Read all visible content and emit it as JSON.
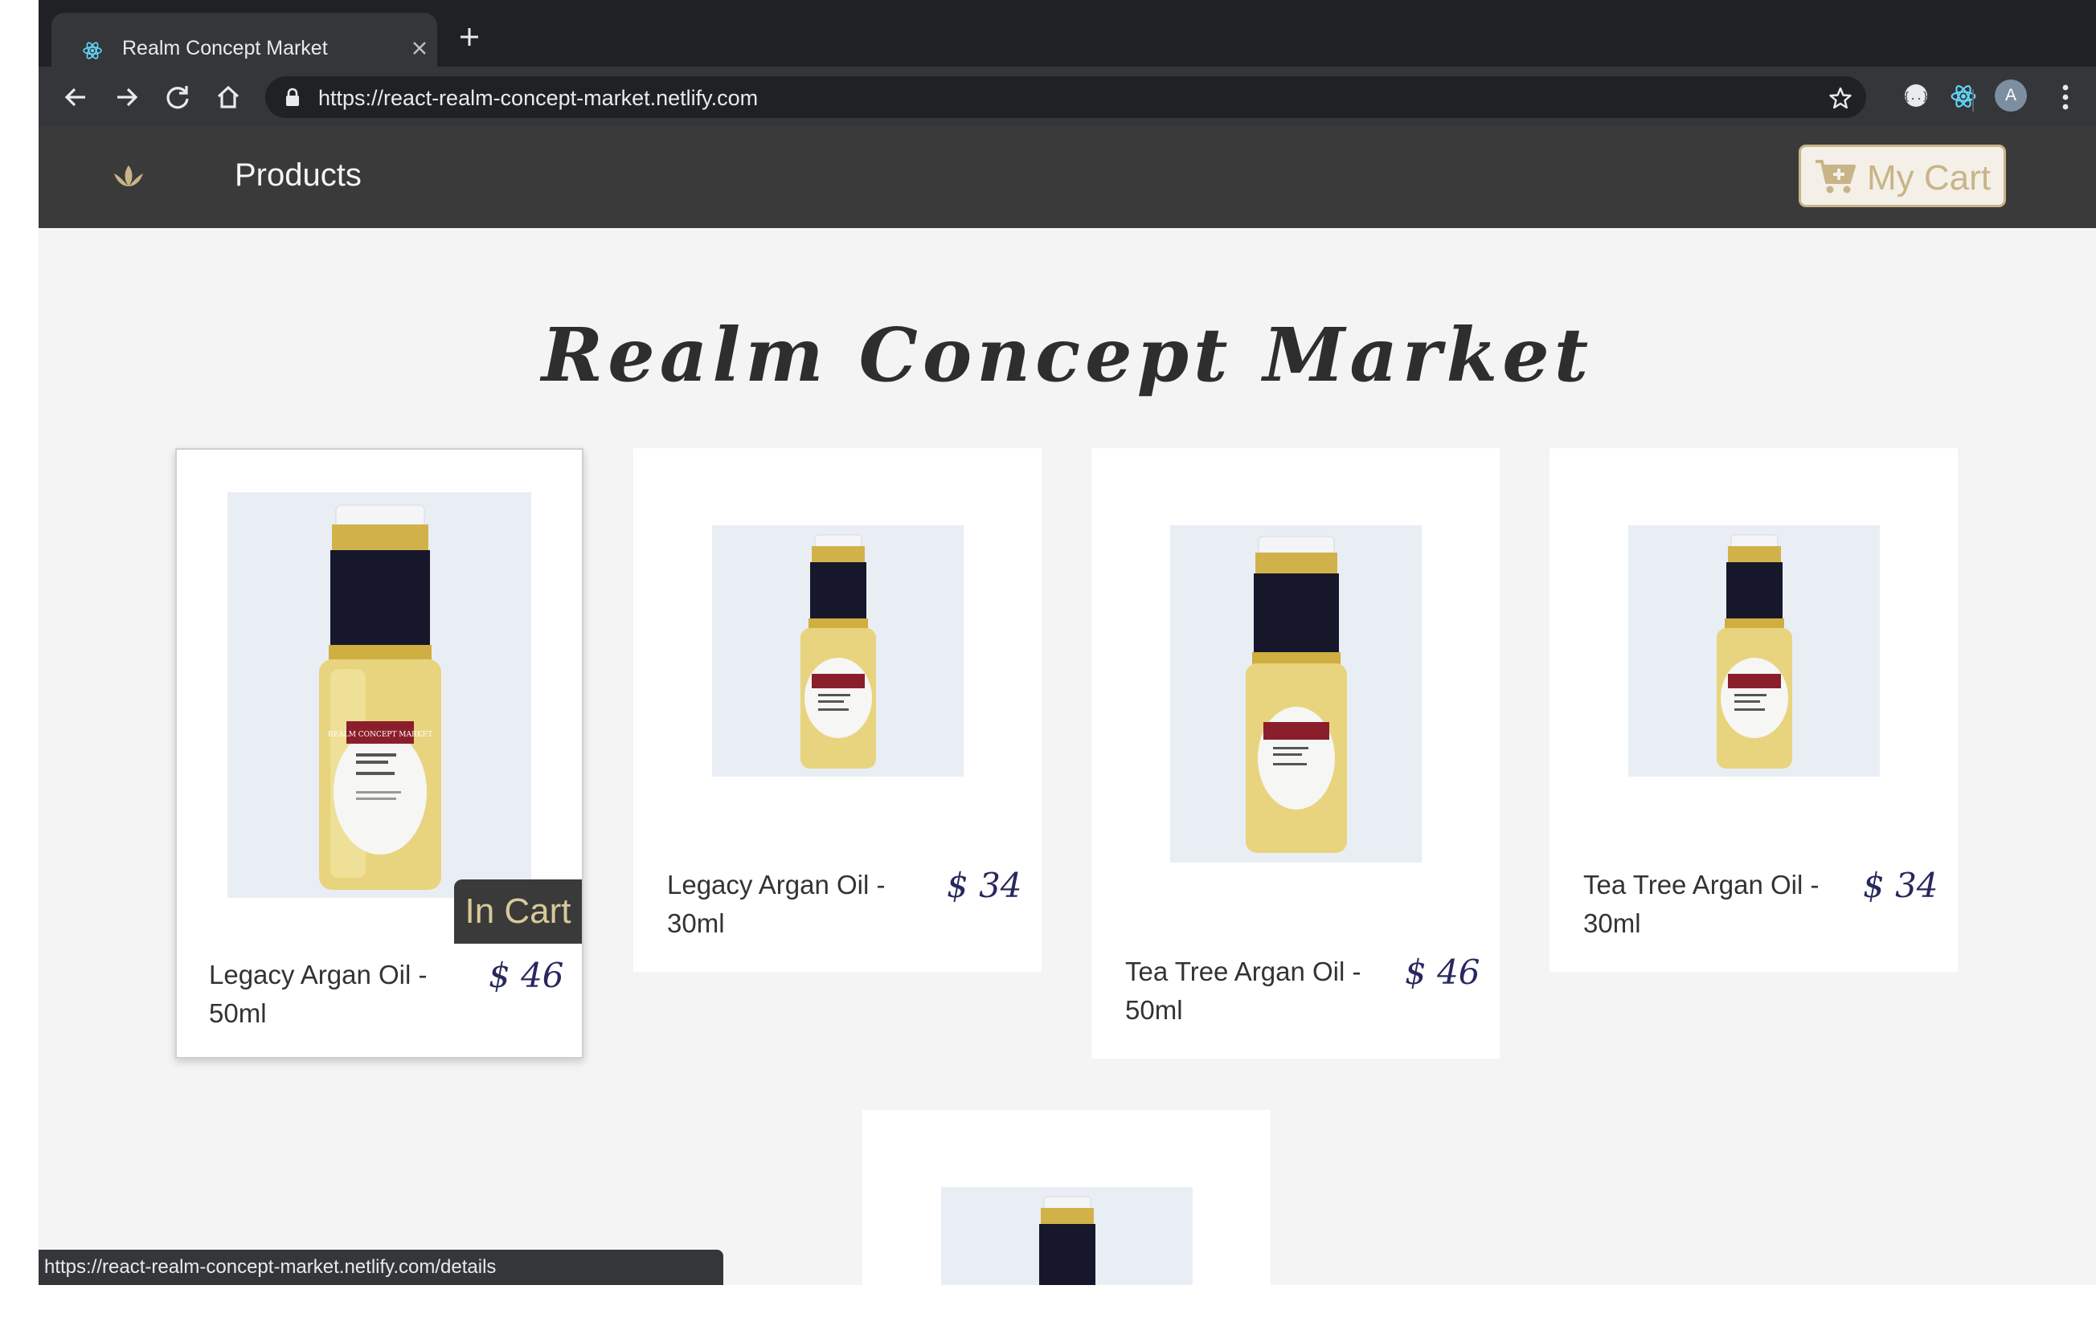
{
  "browser": {
    "tab_title": "Realm Concept Market",
    "url": "https://react-realm-concept-market.netlify.com",
    "profile_initial": "A",
    "status_url": "https://react-realm-concept-market.netlify.com/details"
  },
  "site": {
    "nav": {
      "products_label": "Products",
      "cart_label": "My Cart"
    },
    "title": "Realm Concept Market",
    "in_cart_label": "In Cart",
    "products": [
      {
        "name": "Legacy Argan Oil - 50ml",
        "price": "$ 46",
        "in_cart": true
      },
      {
        "name": "Legacy Argan Oil - 30ml",
        "price": "$ 34",
        "in_cart": false
      },
      {
        "name": "Tea Tree Argan Oil - 50ml",
        "price": "$ 46",
        "in_cart": false
      },
      {
        "name": "Tea Tree Argan Oil - 30ml",
        "price": "$ 34",
        "in_cart": false
      }
    ],
    "bottle_label": "REALM CONCEPT MARKET"
  },
  "colors": {
    "nav_bg": "#3a3a3a",
    "accent_gold": "#c8b486",
    "price": "#27285e",
    "page_bg": "#f4f4f4"
  },
  "icons": [
    "react-logo-icon",
    "close-icon",
    "plus-icon",
    "back-arrow-icon",
    "forward-arrow-icon",
    "reload-icon",
    "home-icon",
    "lock-icon",
    "star-icon",
    "extension-icon",
    "kebab-menu-icon",
    "lotus-logo-icon",
    "cart-plus-icon"
  ]
}
